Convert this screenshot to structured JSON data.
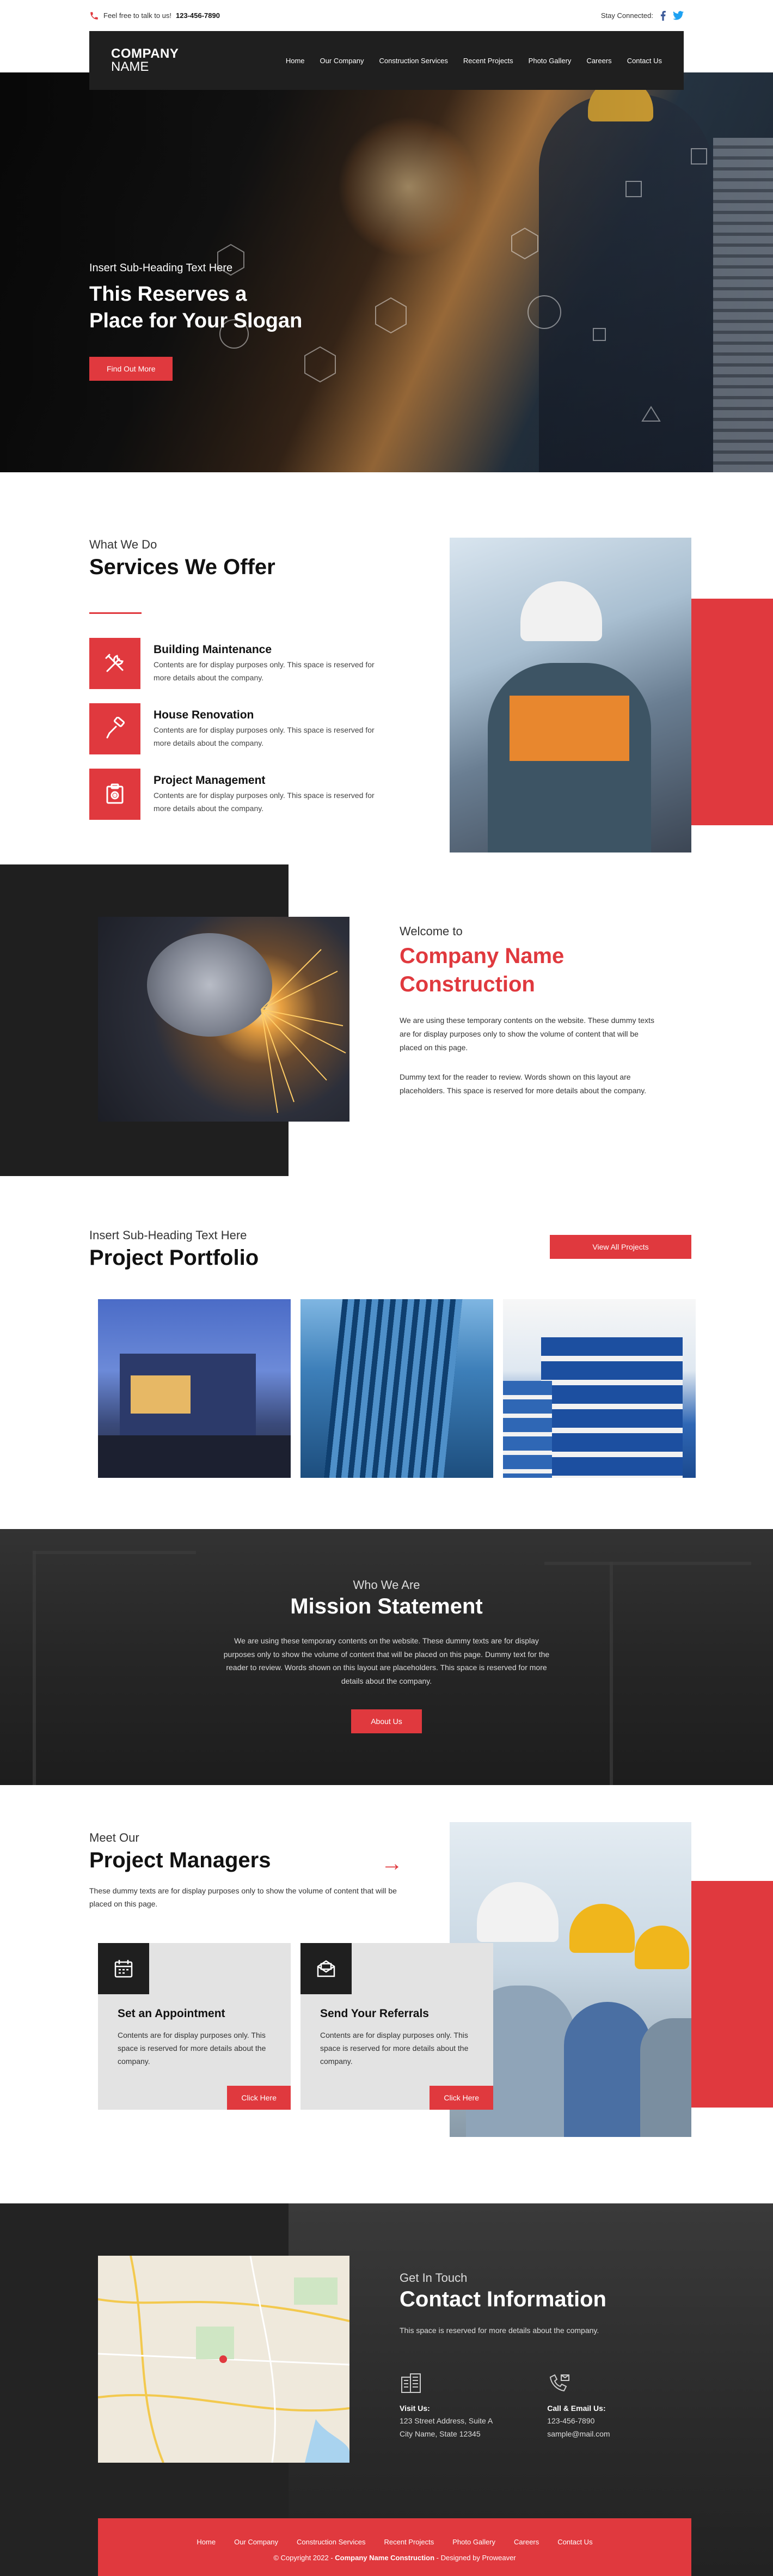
{
  "topbar": {
    "phone_text": "Feel free to talk to us!",
    "phone_number": "123-456-7890",
    "stay_connected": "Stay Connected:"
  },
  "logo": {
    "line1": "COMPANY",
    "line2": "NAME"
  },
  "nav": [
    "Home",
    "Our Company",
    "Construction Services",
    "Recent Projects",
    "Photo Gallery",
    "Careers",
    "Contact Us"
  ],
  "hero": {
    "subheading": "Insert Sub-Heading Text Here",
    "slogan_line1": "This Reserves a",
    "slogan_line2": "Place for Your Slogan",
    "button": "Find Out More"
  },
  "services": {
    "eyebrow": "What We Do",
    "title": "Services We Offer",
    "items": [
      {
        "title": "Building Maintenance",
        "text": "Contents are for display purposes only. This space is reserved for more details about the company.",
        "icon": "tools-icon"
      },
      {
        "title": "House Renovation",
        "text": "Contents are for display purposes only. This space is reserved for more details about the company.",
        "icon": "paint-roller-icon"
      },
      {
        "title": "Project Management",
        "text": "Contents are for display purposes only. This space is reserved for more details about the company.",
        "icon": "settings-clipboard-icon"
      }
    ]
  },
  "welcome": {
    "eyebrow": "Welcome to",
    "title_line1": "Company Name",
    "title_line2": "Construction",
    "p1": "We are using these temporary contents on the website. These dummy texts are for display purposes only to show the volume of content that will be placed on this page.",
    "p2": "Dummy text for the reader to review. Words shown on this layout are placeholders. This space is reserved for more details about the company."
  },
  "portfolio": {
    "eyebrow": "Insert Sub-Heading Text Here",
    "title": "Project Portfolio",
    "button": "View All Projects"
  },
  "mission": {
    "eyebrow": "Who We Are",
    "title": "Mission Statement",
    "text": "We are using these temporary contents on the website. These dummy texts are for display purposes only to show the volume of content that will be placed on this page. Dummy text for the reader to review. Words shown on this layout are placeholders. This space is reserved for more details about the company.",
    "button": "About Us"
  },
  "managers": {
    "eyebrow": "Meet Our",
    "title": "Project Managers",
    "desc": "These dummy texts are for display purposes only to show the volume of content that will be placed on this page.",
    "cards": [
      {
        "title": "Set an Appointment",
        "text": "Contents are for display purposes only. This space is reserved for more details about the company.",
        "button": "Click Here",
        "icon": "calendar-icon"
      },
      {
        "title": "Send Your Referrals",
        "text": "Contents are for display purposes only. This space is reserved for more details about the company.",
        "button": "Click Here",
        "icon": "mail-icon"
      }
    ]
  },
  "contact": {
    "eyebrow": "Get In Touch",
    "title": "Contact Information",
    "intro": "This space is reserved for more details about the company.",
    "visit_label": "Visit Us:",
    "address1": "123 Street Address, Suite A",
    "address2": "City Name, State 12345",
    "call_label": "Call & Email Us:",
    "phone": "123-456-7890",
    "email": "sample@mail.com"
  },
  "footer": {
    "links": [
      "Home",
      "Our Company",
      "Construction Services",
      "Recent Projects",
      "Photo Gallery",
      "Careers",
      "Contact Us"
    ],
    "copyright": "© Copyright 2022 -",
    "company": "Company Name Construction",
    "designed": "- Designed by Proweaver"
  },
  "colors": {
    "accent": "#e0393e",
    "dark": "#1f1f1f",
    "facebook": "#3b5998",
    "twitter": "#1da1f2"
  }
}
